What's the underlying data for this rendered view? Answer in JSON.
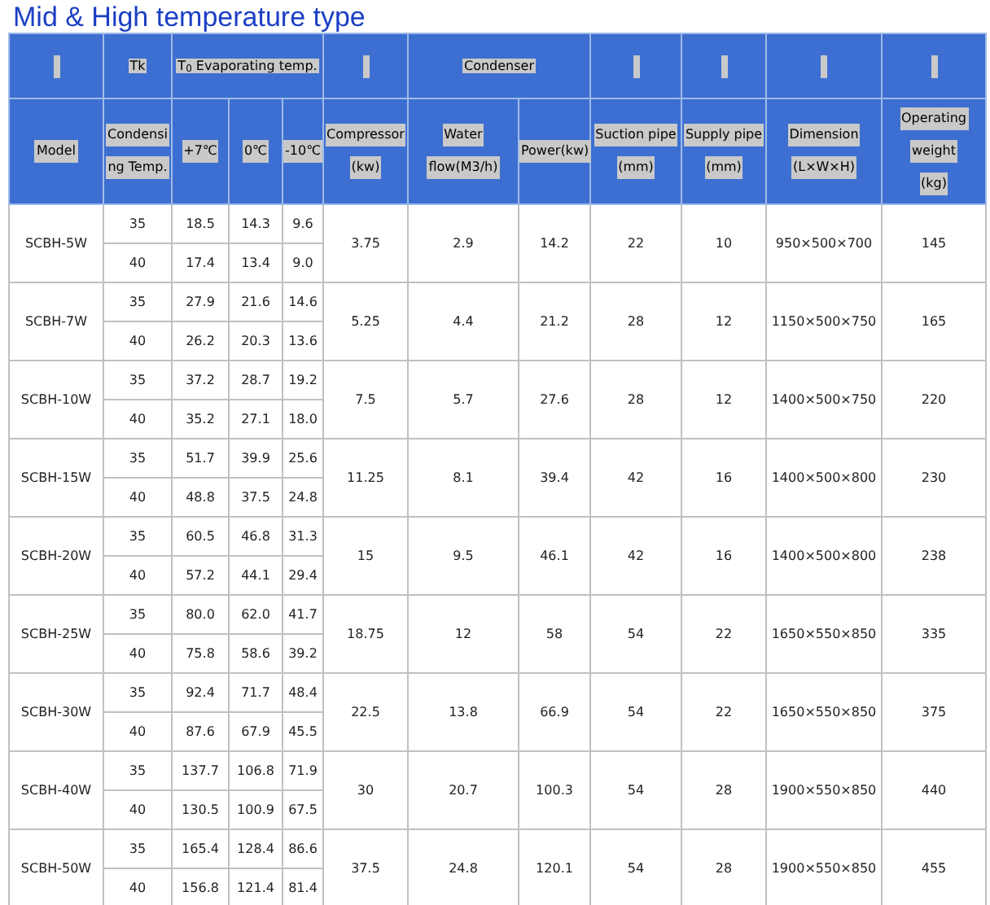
{
  "title": "Mid & High temperature type",
  "group_headers": [
    {
      "kind": "blank"
    },
    {
      "kind": "label",
      "text": "Tk"
    },
    {
      "kind": "label",
      "text": "T$_{0}$ Evaporating temp."
    },
    {
      "kind": "blank"
    },
    {
      "kind": "label",
      "text": "Condenser"
    },
    {
      "kind": "blank"
    },
    {
      "kind": "blank"
    },
    {
      "kind": "blank"
    },
    {
      "kind": "blank"
    }
  ],
  "columns": [
    [
      "Model"
    ],
    [
      "Condensi",
      "ng Temp."
    ],
    [
      "+7℃"
    ],
    [
      "0℃"
    ],
    [
      "-10℃"
    ],
    [
      "Compressor",
      "(kw)"
    ],
    [
      "Water",
      "flow(M3/h)"
    ],
    [
      "Power(kw)"
    ],
    [
      "Suction pipe",
      "(mm)"
    ],
    [
      "Supply pipe",
      "(mm)"
    ],
    [
      "Dimension",
      "(L×W×H)"
    ],
    [
      "Operating",
      "weight",
      "(kg)"
    ]
  ],
  "rows": [
    {
      "model": "SCBH-5W",
      "tk": [
        "35",
        "40"
      ],
      "plus7": [
        "18.5",
        "17.4"
      ],
      "zero": [
        "14.3",
        "13.4"
      ],
      "minus10": [
        "9.6",
        "9.0"
      ],
      "compressor": "3.75",
      "water_flow": "2.9",
      "power": "14.2",
      "suction": "22",
      "supply": "10",
      "dimension": "950×500×700",
      "weight": "145"
    },
    {
      "model": "SCBH-7W",
      "tk": [
        "35",
        "40"
      ],
      "plus7": [
        "27.9",
        "26.2"
      ],
      "zero": [
        "21.6",
        "20.3"
      ],
      "minus10": [
        "14.6",
        "13.6"
      ],
      "compressor": "5.25",
      "water_flow": "4.4",
      "power": "21.2",
      "suction": "28",
      "supply": "12",
      "dimension": "1150×500×750",
      "weight": "165"
    },
    {
      "model": "SCBH-10W",
      "tk": [
        "35",
        "40"
      ],
      "plus7": [
        "37.2",
        "35.2"
      ],
      "zero": [
        "28.7",
        "27.1"
      ],
      "minus10": [
        "19.2",
        "18.0"
      ],
      "compressor": "7.5",
      "water_flow": "5.7",
      "power": "27.6",
      "suction": "28",
      "supply": "12",
      "dimension": "1400×500×750",
      "weight": "220"
    },
    {
      "model": "SCBH-15W",
      "tk": [
        "35",
        "40"
      ],
      "plus7": [
        "51.7",
        "48.8"
      ],
      "zero": [
        "39.9",
        "37.5"
      ],
      "minus10": [
        "25.6",
        "24.8"
      ],
      "compressor": "11.25",
      "water_flow": "8.1",
      "power": "39.4",
      "suction": "42",
      "supply": "16",
      "dimension": "1400×500×800",
      "weight": "230"
    },
    {
      "model": "SCBH-20W",
      "tk": [
        "35",
        "40"
      ],
      "plus7": [
        "60.5",
        "57.2"
      ],
      "zero": [
        "46.8",
        "44.1"
      ],
      "minus10": [
        "31.3",
        "29.4"
      ],
      "compressor": "15",
      "water_flow": "9.5",
      "power": "46.1",
      "suction": "42",
      "supply": "16",
      "dimension": "1400×500×800",
      "weight": "238"
    },
    {
      "model": "SCBH-25W",
      "tk": [
        "35",
        "40"
      ],
      "plus7": [
        "80.0",
        "75.8"
      ],
      "zero": [
        "62.0",
        "58.6"
      ],
      "minus10": [
        "41.7",
        "39.2"
      ],
      "compressor": "18.75",
      "water_flow": "12",
      "power": "58",
      "suction": "54",
      "supply": "22",
      "dimension": "1650×550×850",
      "weight": "335"
    },
    {
      "model": "SCBH-30W",
      "tk": [
        "35",
        "40"
      ],
      "plus7": [
        "92.4",
        "87.6"
      ],
      "zero": [
        "71.7",
        "67.9"
      ],
      "minus10": [
        "48.4",
        "45.5"
      ],
      "compressor": "22.5",
      "water_flow": "13.8",
      "power": "66.9",
      "suction": "54",
      "supply": "22",
      "dimension": "1650×550×850",
      "weight": "375"
    },
    {
      "model": "SCBH-40W",
      "tk": [
        "35",
        "40"
      ],
      "plus7": [
        "137.7",
        "130.5"
      ],
      "zero": [
        "106.8",
        "100.9"
      ],
      "minus10": [
        "71.9",
        "67.5"
      ],
      "compressor": "30",
      "water_flow": "20.7",
      "power": "100.3",
      "suction": "54",
      "supply": "28",
      "dimension": "1900×550×850",
      "weight": "440"
    },
    {
      "model": "SCBH-50W",
      "tk": [
        "35",
        "40"
      ],
      "plus7": [
        "165.4",
        "156.8"
      ],
      "zero": [
        "128.4",
        "121.4"
      ],
      "minus10": [
        "86.6",
        "81.4"
      ],
      "compressor": "37.5",
      "water_flow": "24.8",
      "power": "120.1",
      "suction": "54",
      "supply": "28",
      "dimension": "1900×550×850",
      "weight": "455"
    }
  ]
}
